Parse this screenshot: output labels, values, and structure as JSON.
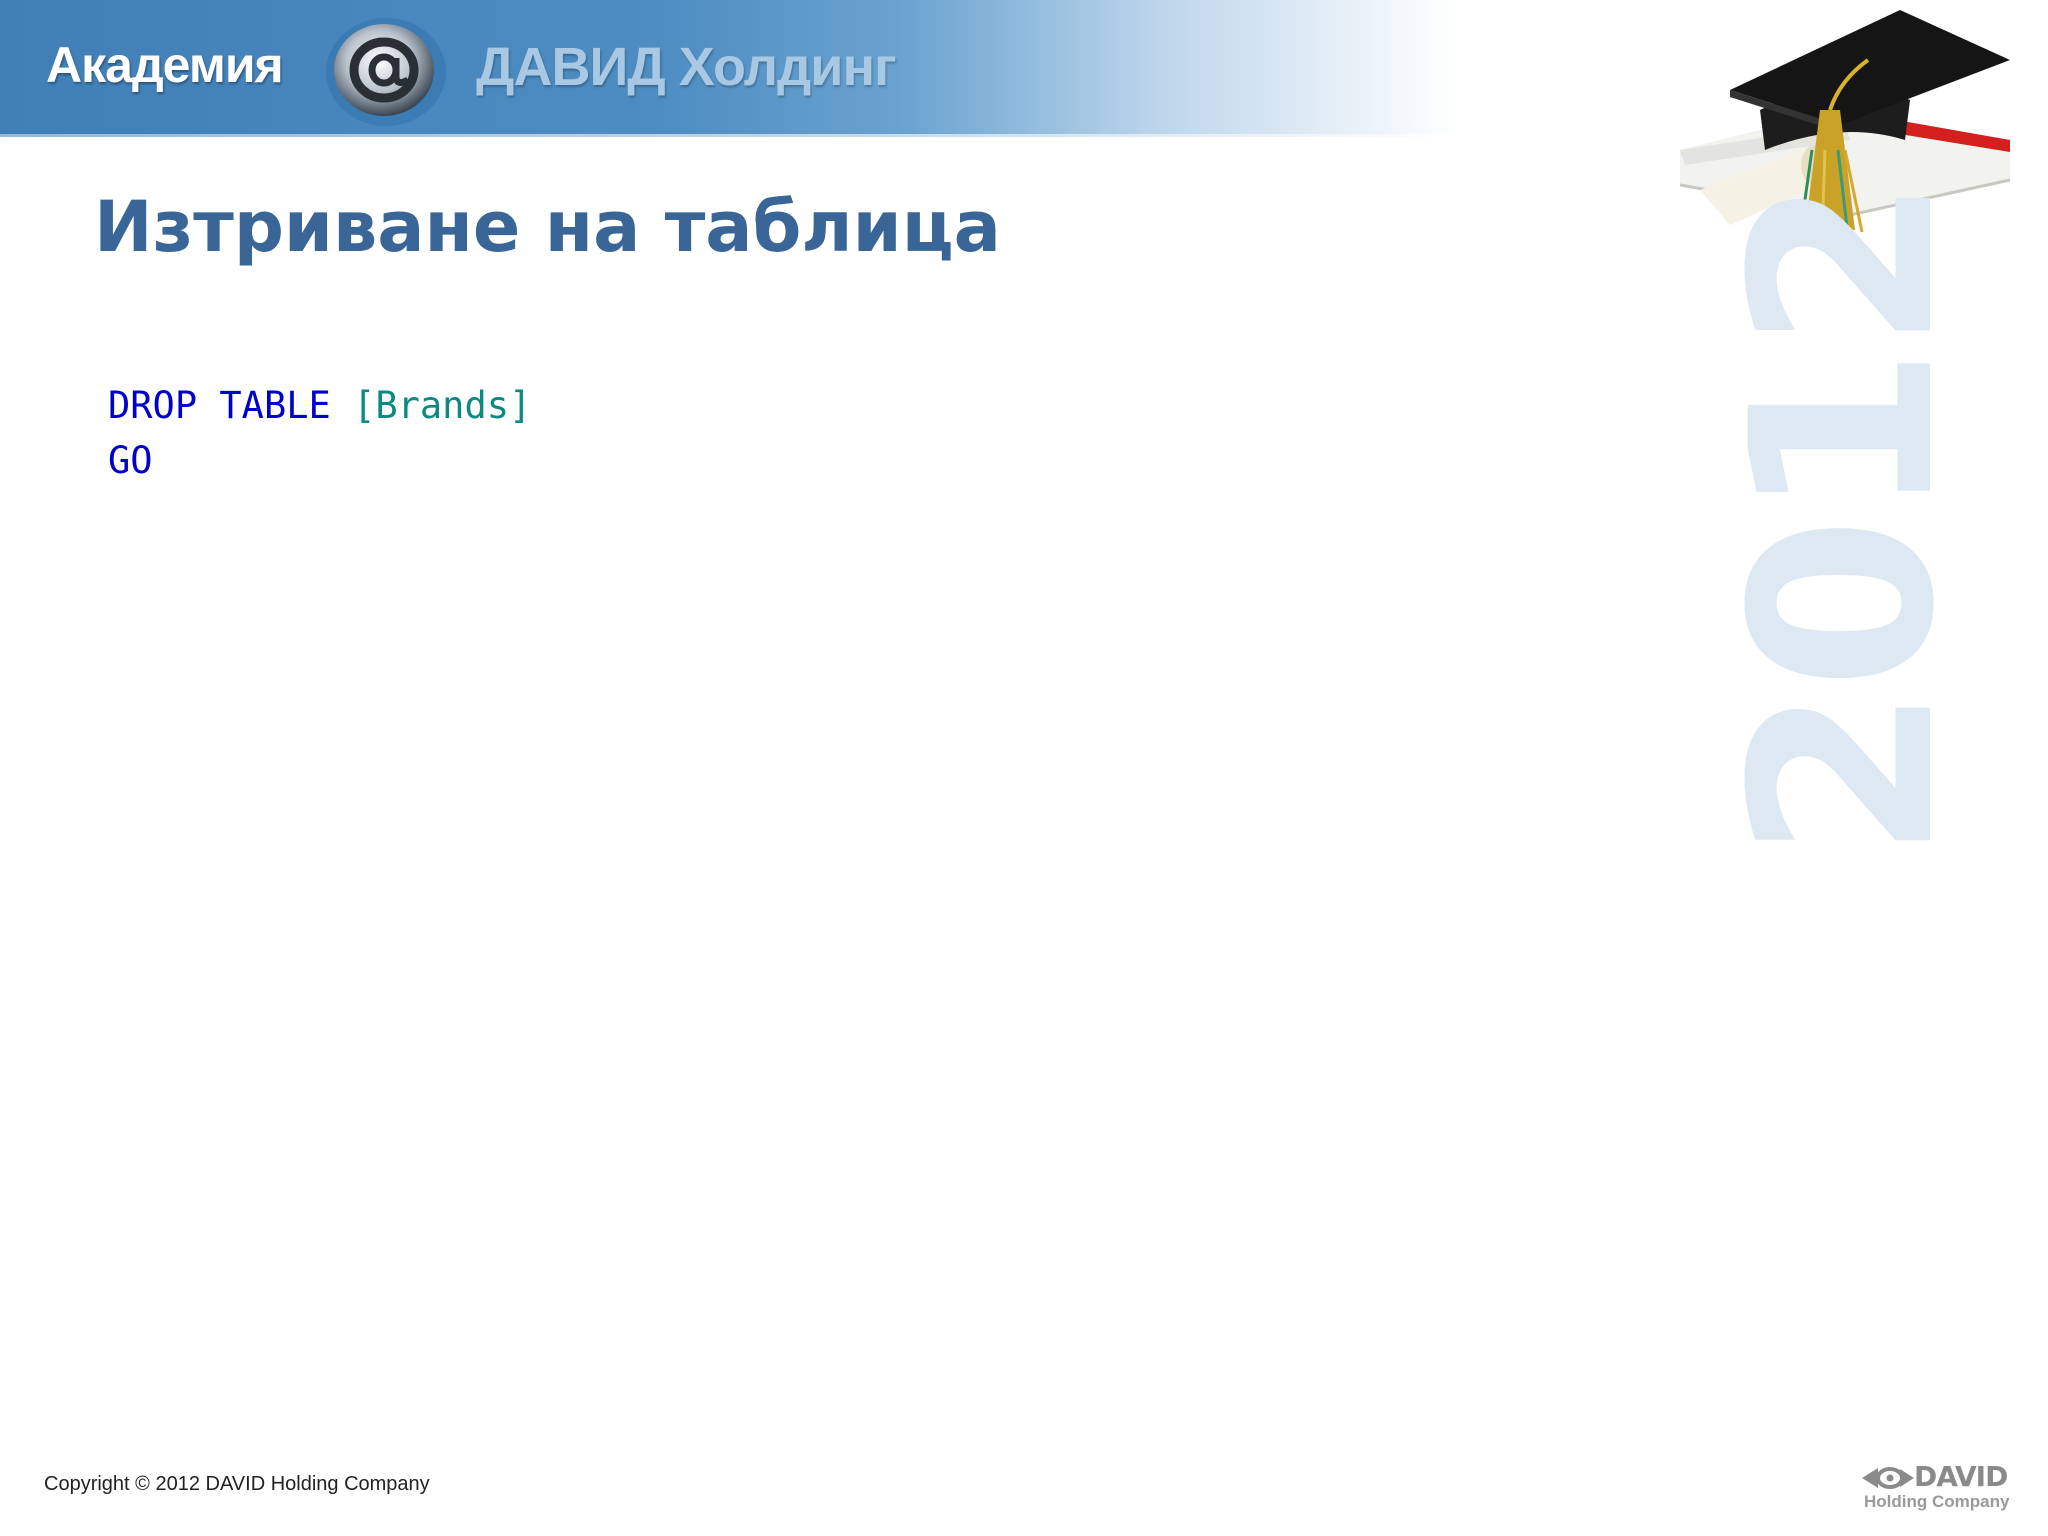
{
  "header": {
    "left_text": "Академия",
    "right_text": "ДАВИД Холдинг",
    "logo_icon": "at-sign-logo-icon",
    "colors": {
      "banner_blue": "#4d8dc2",
      "banner_text_light": "#a9c8e4"
    }
  },
  "slide": {
    "title": "Изтриване на таблица",
    "code": {
      "line1": {
        "keyword1": "DROP",
        "keyword2": "TABLE",
        "identifier": "[Brands]"
      },
      "line2": {
        "keyword": "GO"
      }
    },
    "watermark": "2012",
    "decoration_icon": "graduation-cap-icon",
    "colors": {
      "title": "#3a6597",
      "keyword": "#0000cd",
      "identifier": "#0a8a80"
    }
  },
  "footer": {
    "copyright": "Copyright © 2012 DAVID Holding Company",
    "logo_name": "DAVID",
    "logo_sub": "Holding Company",
    "logo_icon": "david-eye-logo-icon"
  }
}
